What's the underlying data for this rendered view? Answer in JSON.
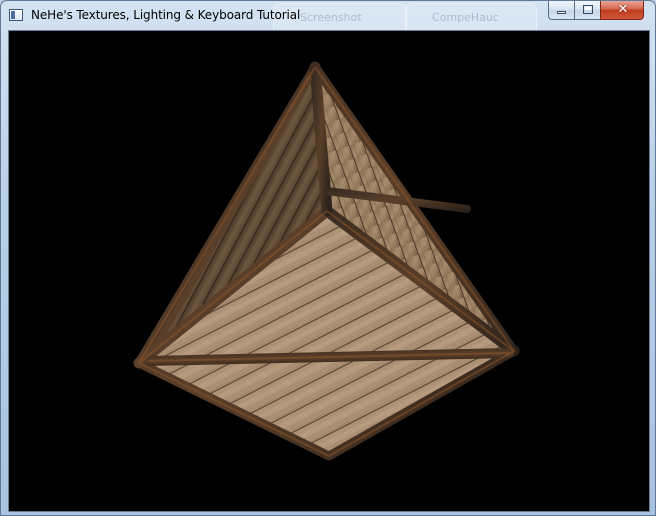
{
  "window": {
    "title": "NeHe's Textures, Lighting & Keyboard Tutorial",
    "app_icon": "window-app-icon",
    "caption_buttons": {
      "minimize_icon": "minimize-icon",
      "maximize_icon": "maximize-icon",
      "close_glyph": "✕"
    },
    "ghost_tabs": [
      "Screenshot",
      "CompeHauc"
    ]
  },
  "scene": {
    "background_color": "#000000",
    "object": "textured wooden crate cube",
    "wood_light": "#a08466",
    "wood_dark": "#5e4530",
    "frame_color": "#3e2c20",
    "rust_color": "#7a4a25"
  }
}
